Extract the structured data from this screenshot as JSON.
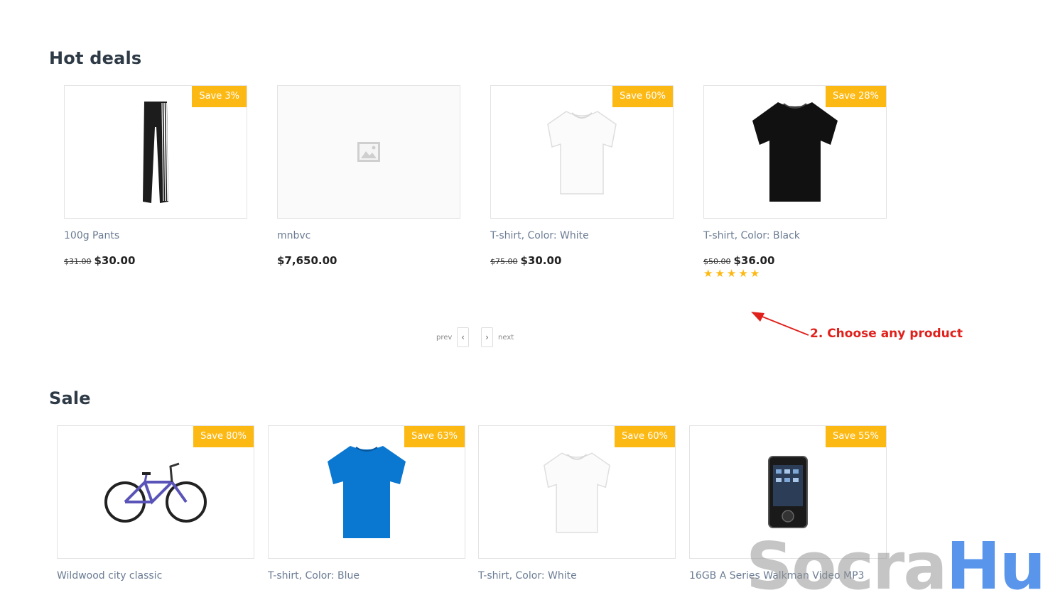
{
  "hot_deals": {
    "title": "Hot deals",
    "products": [
      {
        "name": "100g Pants",
        "badge": "Save 3%",
        "old_price": "$31.00",
        "price": "$30.00",
        "image": "pants"
      },
      {
        "name": "mnbvc",
        "badge": "",
        "old_price": "",
        "price": "$7,650.00",
        "image": "placeholder-icon"
      },
      {
        "name": "T-shirt, Color: White",
        "badge": "Save 60%",
        "old_price": "$75.00",
        "price": "$30.00",
        "image": "white-tshirt"
      },
      {
        "name": "T-shirt, Color: Black",
        "badge": "Save 28%",
        "old_price": "$50.00",
        "price": "$36.00",
        "image": "black-tshirt",
        "rating": 5,
        "stars": "★★★★★"
      }
    ],
    "pager": {
      "prev": "prev",
      "next": "next"
    }
  },
  "sale": {
    "title": "Sale",
    "products": [
      {
        "name": "Wildwood city classic",
        "badge": "Save 80%",
        "image": "bicycle"
      },
      {
        "name": "T-shirt, Color: Blue",
        "badge": "Save 63%",
        "image": "blue-tshirt"
      },
      {
        "name": "T-shirt, Color: White",
        "badge": "Save 60%",
        "image": "white-tshirt"
      },
      {
        "name": "16GB A Series Walkman Video MP3",
        "badge": "Save 55%",
        "image": "mp3-player"
      }
    ]
  },
  "annotation": {
    "text": "2. Choose any product",
    "color": "#e0201b"
  },
  "watermark": {
    "part1": "Socra",
    "part2": "Hub"
  },
  "colors": {
    "badge": "#fdb913",
    "title": "#2e3a46",
    "product_name": "#6b7c93"
  }
}
